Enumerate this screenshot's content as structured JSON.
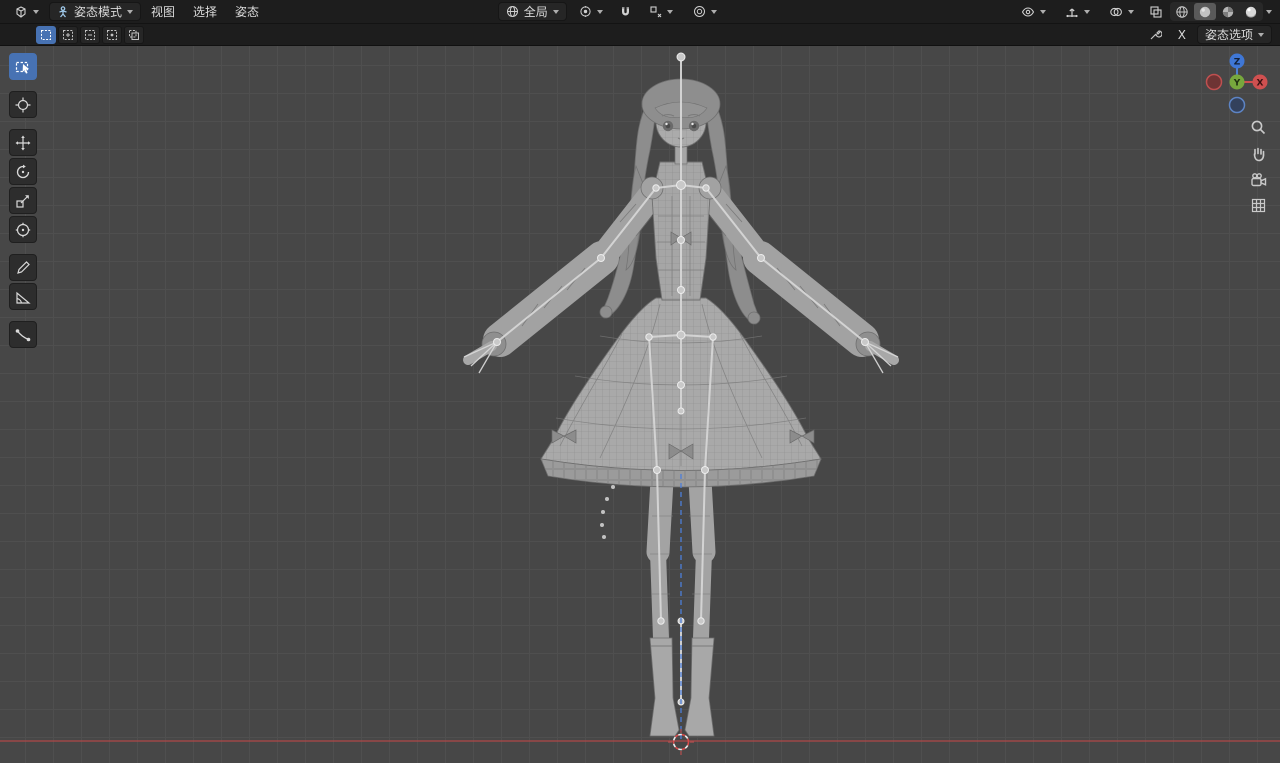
{
  "header": {
    "mode": {
      "label": "姿态模式"
    },
    "menus": [
      {
        "label": "视图"
      },
      {
        "label": "选择"
      },
      {
        "label": "姿态"
      }
    ],
    "orientation": {
      "label": "全局"
    }
  },
  "tool_settings": {
    "close": {
      "label": "X"
    },
    "pose_options": {
      "label": "姿态选项"
    }
  },
  "nav_gizmo": {
    "axis_x": "X",
    "axis_y": "Y",
    "axis_z": "Z"
  },
  "colors": {
    "accent": "#4772b3",
    "axis_x": "#d05050",
    "axis_y": "#77a83d",
    "axis_z": "#3f77d6",
    "header_bg": "#1d1d1d",
    "viewport_bg": "#474747",
    "floor_x_axis_line": "#a84848",
    "bone_wire": "#d6d6d6",
    "ik_dash_line": "#4d7fd9"
  },
  "icons": {
    "editor_type": "viewport-cube",
    "pose_mode": "person",
    "orientation": "globe",
    "pivot": "pivot-point",
    "snap": "magnet",
    "snap_target": "snap-to",
    "proportional": "concentric-circles",
    "visibility": "eye",
    "gizmos": "axis-arrows",
    "overlays": "overlapping-circles",
    "xray": "overlapping-squares",
    "shading_modes": [
      "wireframe-sphere",
      "solid-sphere",
      "material-sphere",
      "rendered-sphere"
    ],
    "active_shading": "solid-sphere",
    "tools": [
      "box-select",
      "cursor",
      "move",
      "rotate",
      "scale",
      "transform",
      "annotate",
      "measure",
      "pose-breakdowner"
    ],
    "select_modes": [
      "set",
      "extend",
      "subtract",
      "invert",
      "intersect"
    ],
    "nav_overlay": [
      "magnifier",
      "hand",
      "camera",
      "grid"
    ]
  }
}
